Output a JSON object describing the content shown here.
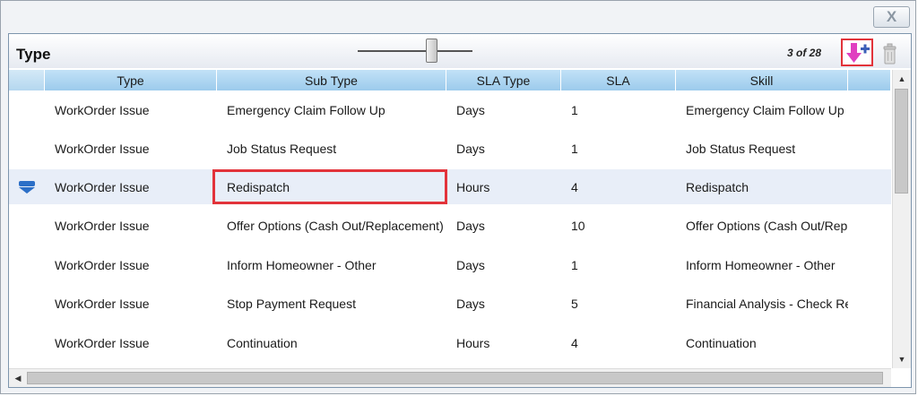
{
  "window": {
    "close_label": "X"
  },
  "panel": {
    "title": "Type",
    "page_count": "3 of 28",
    "add_icon": "download-add-icon",
    "delete_icon": "trash-icon"
  },
  "grid": {
    "columns": [
      {
        "label": ""
      },
      {
        "label": "Type"
      },
      {
        "label": "Sub Type"
      },
      {
        "label": "SLA Type"
      },
      {
        "label": "SLA"
      },
      {
        "label": "Skill"
      },
      {
        "label": ""
      }
    ],
    "rows": [
      {
        "type": "WorkOrder Issue",
        "subtype": "Emergency Claim Follow Up",
        "sla_type": "Days",
        "sla": "1",
        "skill": "Emergency Claim Follow Up"
      },
      {
        "type": "WorkOrder Issue",
        "subtype": "Job Status Request",
        "sla_type": "Days",
        "sla": "1",
        "skill": "Job Status Request"
      },
      {
        "type": "WorkOrder Issue",
        "subtype": "Redispatch",
        "sla_type": "Hours",
        "sla": "4",
        "skill": "Redispatch",
        "selected": true
      },
      {
        "type": "WorkOrder Issue",
        "subtype": "Offer Options (Cash Out/Replacement)",
        "sla_type": "Days",
        "sla": "10",
        "skill": "Offer Options (Cash Out/Replacement)"
      },
      {
        "type": "WorkOrder Issue",
        "subtype": "Inform Homeowner - Other",
        "sla_type": "Days",
        "sla": "1",
        "skill": "Inform Homeowner - Other"
      },
      {
        "type": "WorkOrder Issue",
        "subtype": "Stop Payment Request",
        "sla_type": "Days",
        "sla": "5",
        "skill": "Financial Analysis - Check Request"
      },
      {
        "type": "WorkOrder Issue",
        "subtype": "Continuation",
        "sla_type": "Hours",
        "sla": "4",
        "skill": "Continuation"
      }
    ],
    "selected_row_icon": "row-expand-icon"
  },
  "colors": {
    "header_blue": "#a9d2ef",
    "highlight_red": "#e2333a",
    "selected_row": "#e8eef8",
    "add_icon_magenta": "#e040c0"
  }
}
